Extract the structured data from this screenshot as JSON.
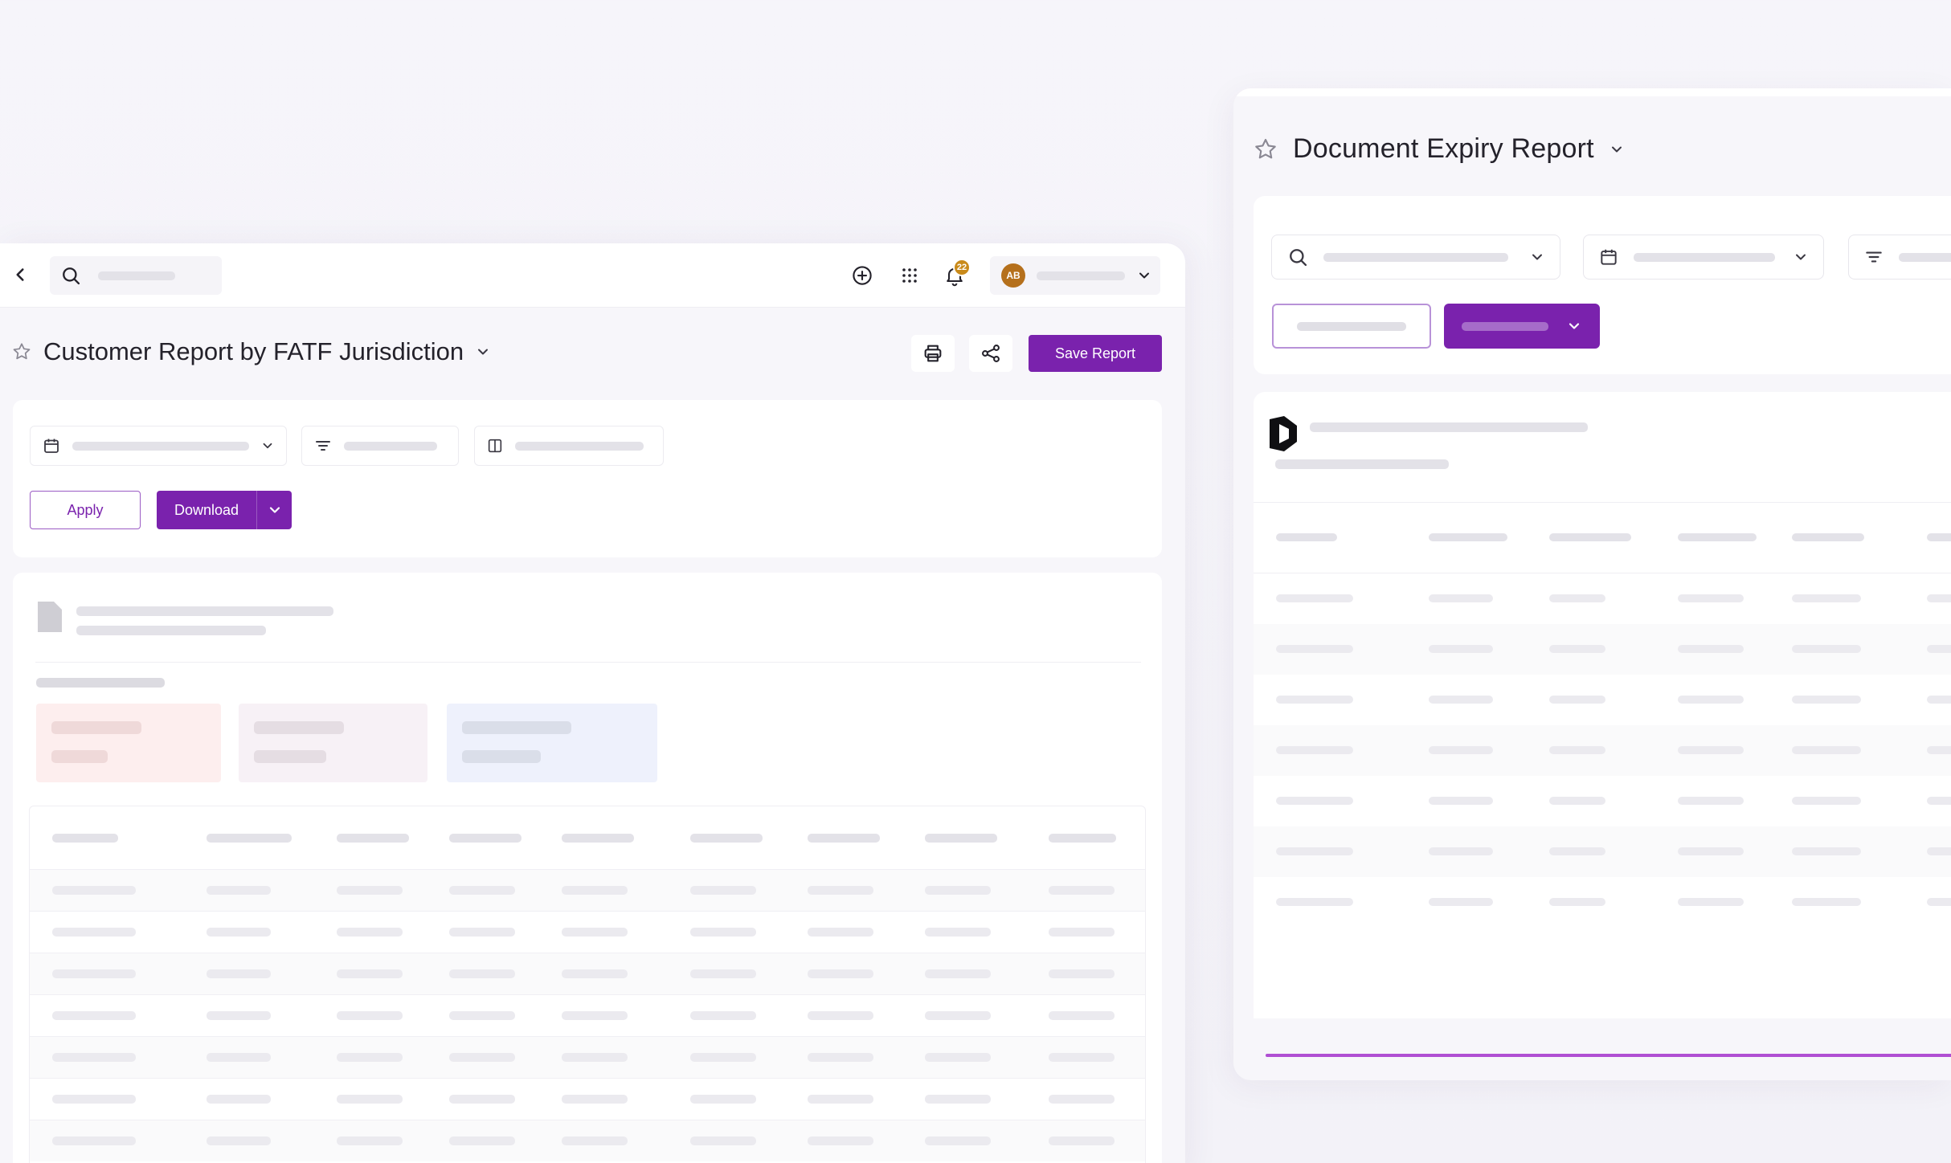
{
  "left_window": {
    "report_title": "Customer Report by FATF Jurisdiction",
    "notification_count": "22",
    "user_initials": "AB",
    "actions": {
      "save_label": "Save Report",
      "apply_label": "Apply",
      "download_label": "Download"
    }
  },
  "right_window": {
    "report_title": "Document Expiry Report"
  },
  "icons": {
    "back": "chevron-left-icon",
    "search": "search-icon",
    "add": "plus-circle-icon",
    "apps": "grid-icon",
    "notifications": "bell-icon",
    "favorite": "star-icon",
    "print": "printer-icon",
    "share": "share-icon",
    "calendar": "calendar-icon",
    "filter": "filter-icon",
    "columns": "columns-icon",
    "document": "document-icon",
    "dropdown": "chevron-down-icon"
  },
  "colors": {
    "accent": "#7a22ad",
    "badge": "#c98a1a",
    "avatar": "#b5701c",
    "progress": "#b04fd3",
    "tile_red": "#fdeeee",
    "tile_pink": "#f7f1f6",
    "tile_blue": "#eef1fc"
  }
}
